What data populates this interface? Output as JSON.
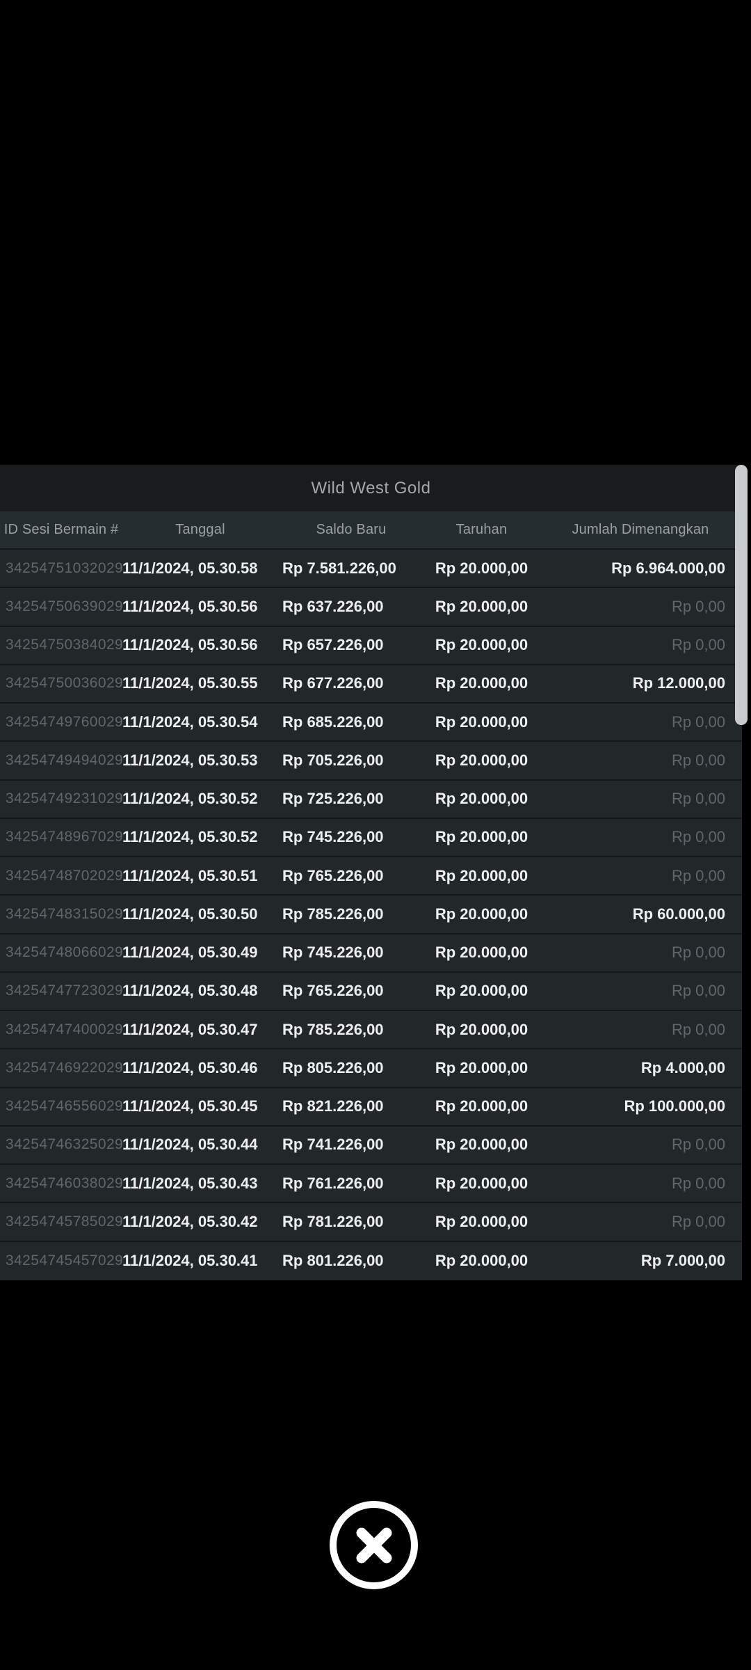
{
  "dialog": {
    "title": "Wild West Gold",
    "table": {
      "columns": [
        {
          "key": "id",
          "label": "ID Sesi Bermain #"
        },
        {
          "key": "date",
          "label": "Tanggal"
        },
        {
          "key": "balance",
          "label": "Saldo Baru"
        },
        {
          "key": "bet",
          "label": "Taruhan"
        },
        {
          "key": "win",
          "label": "Jumlah Dimenangkan"
        }
      ],
      "rows": [
        {
          "id": "34254751032029",
          "date": "11/1/2024, 05.30.58",
          "balance": "Rp 7.581.226,00",
          "bet": "Rp 20.000,00",
          "win": "Rp 6.964.000,00"
        },
        {
          "id": "34254750639029",
          "date": "11/1/2024, 05.30.56",
          "balance": "Rp 637.226,00",
          "bet": "Rp 20.000,00",
          "win": "Rp 0,00"
        },
        {
          "id": "34254750384029",
          "date": "11/1/2024, 05.30.56",
          "balance": "Rp 657.226,00",
          "bet": "Rp 20.000,00",
          "win": "Rp 0,00"
        },
        {
          "id": "34254750036029",
          "date": "11/1/2024, 05.30.55",
          "balance": "Rp 677.226,00",
          "bet": "Rp 20.000,00",
          "win": "Rp 12.000,00"
        },
        {
          "id": "34254749760029",
          "date": "11/1/2024, 05.30.54",
          "balance": "Rp 685.226,00",
          "bet": "Rp 20.000,00",
          "win": "Rp 0,00"
        },
        {
          "id": "34254749494029",
          "date": "11/1/2024, 05.30.53",
          "balance": "Rp 705.226,00",
          "bet": "Rp 20.000,00",
          "win": "Rp 0,00"
        },
        {
          "id": "34254749231029",
          "date": "11/1/2024, 05.30.52",
          "balance": "Rp 725.226,00",
          "bet": "Rp 20.000,00",
          "win": "Rp 0,00"
        },
        {
          "id": "34254748967029",
          "date": "11/1/2024, 05.30.52",
          "balance": "Rp 745.226,00",
          "bet": "Rp 20.000,00",
          "win": "Rp 0,00"
        },
        {
          "id": "34254748702029",
          "date": "11/1/2024, 05.30.51",
          "balance": "Rp 765.226,00",
          "bet": "Rp 20.000,00",
          "win": "Rp 0,00"
        },
        {
          "id": "34254748315029",
          "date": "11/1/2024, 05.30.50",
          "balance": "Rp 785.226,00",
          "bet": "Rp 20.000,00",
          "win": "Rp 60.000,00"
        },
        {
          "id": "34254748066029",
          "date": "11/1/2024, 05.30.49",
          "balance": "Rp 745.226,00",
          "bet": "Rp 20.000,00",
          "win": "Rp 0,00"
        },
        {
          "id": "34254747723029",
          "date": "11/1/2024, 05.30.48",
          "balance": "Rp 765.226,00",
          "bet": "Rp 20.000,00",
          "win": "Rp 0,00"
        },
        {
          "id": "34254747400029",
          "date": "11/1/2024, 05.30.47",
          "balance": "Rp 785.226,00",
          "bet": "Rp 20.000,00",
          "win": "Rp 0,00"
        },
        {
          "id": "34254746922029",
          "date": "11/1/2024, 05.30.46",
          "balance": "Rp 805.226,00",
          "bet": "Rp 20.000,00",
          "win": "Rp 4.000,00"
        },
        {
          "id": "34254746556029",
          "date": "11/1/2024, 05.30.45",
          "balance": "Rp 821.226,00",
          "bet": "Rp 20.000,00",
          "win": "Rp 100.000,00"
        },
        {
          "id": "34254746325029",
          "date": "11/1/2024, 05.30.44",
          "balance": "Rp 741.226,00",
          "bet": "Rp 20.000,00",
          "win": "Rp 0,00"
        },
        {
          "id": "34254746038029",
          "date": "11/1/2024, 05.30.43",
          "balance": "Rp 761.226,00",
          "bet": "Rp 20.000,00",
          "win": "Rp 0,00"
        },
        {
          "id": "34254745785029",
          "date": "11/1/2024, 05.30.42",
          "balance": "Rp 781.226,00",
          "bet": "Rp 20.000,00",
          "win": "Rp 0,00"
        },
        {
          "id": "34254745457029",
          "date": "11/1/2024, 05.30.41",
          "balance": "Rp 801.226,00",
          "bet": "Rp 20.000,00",
          "win": "Rp 7.000,00"
        }
      ],
      "zero_win_value": "Rp 0,00"
    },
    "colors": {
      "title_bar_bg": "#191c1e",
      "header_bg": "#262d30",
      "row_bg": "#22272a",
      "separator": "#14171a",
      "text_primary": "#eef0f0",
      "text_muted": "#60676b",
      "header_text": "#9aa0a3",
      "title_text": "#a4a8aa",
      "scrollbar_thumb": "#c9cccd",
      "page_background": "#000000",
      "close_button": "#ffffff"
    }
  }
}
